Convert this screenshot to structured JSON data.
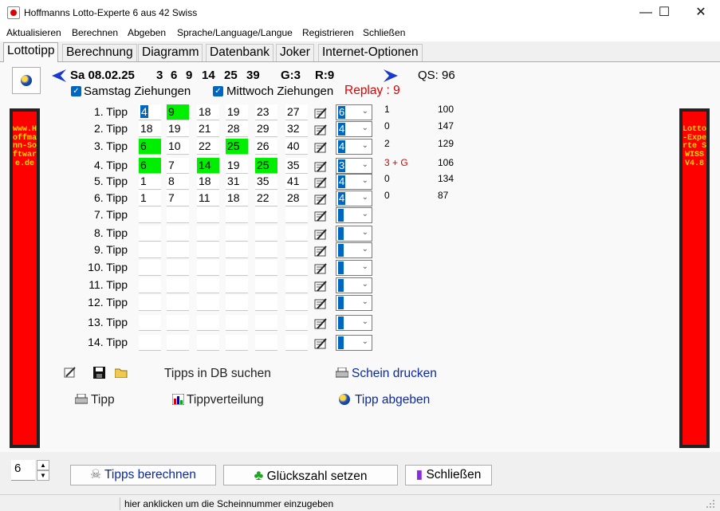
{
  "window": {
    "title": "Hoffmanns Lotto-Experte  6 aus 42 Swiss",
    "minimize": "—",
    "maximize": "☐",
    "close": "✕"
  },
  "menu": [
    "Aktualisieren",
    "Berechnen",
    "Abgeben",
    "Sprache/Language/Langue",
    "Registrieren",
    "Schließen"
  ],
  "tabs": [
    "Lottotipp",
    "Berechnung",
    "Diagramm",
    "Datenbank",
    "Joker",
    "Internet-Optionen"
  ],
  "draw": {
    "date": "Sa 08.02.25",
    "numbers": [
      "3",
      "6",
      "9",
      "14",
      "25",
      "39"
    ],
    "g": "G:3",
    "r": "R:9",
    "qs": "QS: 96"
  },
  "options": {
    "samstag": "Samstag Ziehungen",
    "mittwoch": "Mittwoch Ziehungen",
    "replay": "Replay : 9"
  },
  "side_left": "www.Hoffmann-Software.de",
  "side_right": "Lotto-Experte SWISS V4.8",
  "tips": [
    {
      "label": "1. Tipp",
      "nums": [
        "4",
        "9",
        "18",
        "19",
        "23",
        "27"
      ],
      "hl": [
        false,
        true,
        false,
        false,
        false,
        false
      ],
      "blue": [
        true,
        false,
        false,
        false,
        false,
        false
      ],
      "dd": "6",
      "hits": "1",
      "score": "100"
    },
    {
      "label": "2. Tipp",
      "nums": [
        "18",
        "19",
        "21",
        "28",
        "29",
        "32"
      ],
      "hl": [
        false,
        false,
        false,
        false,
        false,
        false
      ],
      "blue": [
        false,
        false,
        false,
        false,
        false,
        false
      ],
      "dd": "4",
      "hits": "0",
      "score": "147"
    },
    {
      "label": "3. Tipp",
      "nums": [
        "6",
        "10",
        "22",
        "25",
        "26",
        "40"
      ],
      "hl": [
        true,
        false,
        false,
        true,
        false,
        false
      ],
      "blue": [
        false,
        false,
        false,
        false,
        false,
        false
      ],
      "dd": "4",
      "hits": "2",
      "score": "129"
    },
    {
      "label": "4. Tipp",
      "nums": [
        "6",
        "7",
        "14",
        "19",
        "25",
        "35"
      ],
      "hl": [
        true,
        false,
        true,
        false,
        true,
        false
      ],
      "blue": [
        false,
        false,
        false,
        false,
        false,
        false
      ],
      "dd": "3",
      "hits": "3 + G",
      "score": "106"
    },
    {
      "label": "5. Tipp",
      "nums": [
        "1",
        "8",
        "18",
        "31",
        "35",
        "41"
      ],
      "hl": [
        false,
        false,
        false,
        false,
        false,
        false
      ],
      "blue": [
        false,
        false,
        false,
        false,
        false,
        false
      ],
      "dd": "4",
      "hits": "0",
      "score": "134"
    },
    {
      "label": "6. Tipp",
      "nums": [
        "1",
        "7",
        "11",
        "18",
        "22",
        "28"
      ],
      "hl": [
        false,
        false,
        false,
        false,
        false,
        false
      ],
      "blue": [
        false,
        false,
        false,
        false,
        false,
        false
      ],
      "dd": "4",
      "hits": "0",
      "score": "87"
    },
    {
      "label": "7. Tipp",
      "nums": [
        "",
        "",
        "",
        "",
        "",
        ""
      ],
      "hl": [
        false,
        false,
        false,
        false,
        false,
        false
      ],
      "blue": [
        false,
        false,
        false,
        false,
        false,
        false
      ],
      "dd": "",
      "hits": "",
      "score": ""
    },
    {
      "label": "8. Tipp",
      "nums": [
        "",
        "",
        "",
        "",
        "",
        ""
      ],
      "hl": [
        false,
        false,
        false,
        false,
        false,
        false
      ],
      "blue": [
        false,
        false,
        false,
        false,
        false,
        false
      ],
      "dd": "",
      "hits": "",
      "score": ""
    },
    {
      "label": "9. Tipp",
      "nums": [
        "",
        "",
        "",
        "",
        "",
        ""
      ],
      "hl": [
        false,
        false,
        false,
        false,
        false,
        false
      ],
      "blue": [
        false,
        false,
        false,
        false,
        false,
        false
      ],
      "dd": "",
      "hits": "",
      "score": ""
    },
    {
      "label": "10. Tipp",
      "nums": [
        "",
        "",
        "",
        "",
        "",
        ""
      ],
      "hl": [
        false,
        false,
        false,
        false,
        false,
        false
      ],
      "blue": [
        false,
        false,
        false,
        false,
        false,
        false
      ],
      "dd": "",
      "hits": "",
      "score": ""
    },
    {
      "label": "11. Tipp",
      "nums": [
        "",
        "",
        "",
        "",
        "",
        ""
      ],
      "hl": [
        false,
        false,
        false,
        false,
        false,
        false
      ],
      "blue": [
        false,
        false,
        false,
        false,
        false,
        false
      ],
      "dd": "",
      "hits": "",
      "score": ""
    },
    {
      "label": "12. Tipp",
      "nums": [
        "",
        "",
        "",
        "",
        "",
        ""
      ],
      "hl": [
        false,
        false,
        false,
        false,
        false,
        false
      ],
      "blue": [
        false,
        false,
        false,
        false,
        false,
        false
      ],
      "dd": "",
      "hits": "",
      "score": ""
    },
    {
      "label": "13. Tipp",
      "nums": [
        "",
        "",
        "",
        "",
        "",
        ""
      ],
      "hl": [
        false,
        false,
        false,
        false,
        false,
        false
      ],
      "blue": [
        false,
        false,
        false,
        false,
        false,
        false
      ],
      "dd": "",
      "hits": "",
      "score": ""
    },
    {
      "label": "14. Tipp",
      "nums": [
        "",
        "",
        "",
        "",
        "",
        ""
      ],
      "hl": [
        false,
        false,
        false,
        false,
        false,
        false
      ],
      "blue": [
        false,
        false,
        false,
        false,
        false,
        false
      ],
      "dd": "",
      "hits": "",
      "score": ""
    }
  ],
  "actions": {
    "search_db": "Tipps in DB suchen",
    "print_schein": "Schein drucken",
    "tipp": "Tipp",
    "tippverteilung": "Tippverteilung",
    "tipp_abgeben": "Tipp abgeben"
  },
  "bottom": {
    "spin_value": "6",
    "calc": "Tipps berechnen",
    "lucky": "Glückszahl setzen",
    "close": "Schließen"
  },
  "status": "hier anklicken um die Scheinnummer einzugeben",
  "colors": {
    "hit_green": "#00ee00",
    "select_blue": "#0067c0",
    "banner_red": "#ff0000",
    "link_blue": "#0a2aa0",
    "replay_red": "#e00000"
  }
}
